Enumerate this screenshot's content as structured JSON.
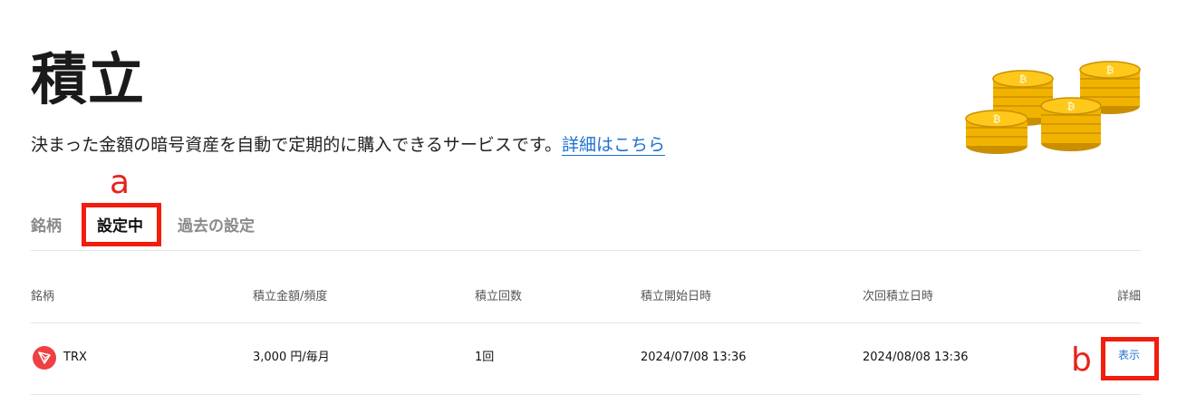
{
  "header": {
    "title": "積立",
    "description": "決まった金額の暗号資産を自動で定期的に購入できるサービスです。",
    "details_link": "詳細はこちら"
  },
  "annotations": {
    "a": "a",
    "b": "b"
  },
  "tabs": [
    {
      "label": "銘柄"
    },
    {
      "label": "設定中",
      "active": true
    },
    {
      "label": "過去の設定"
    }
  ],
  "table": {
    "headers": [
      "銘柄",
      "積立金額/頻度",
      "積立回数",
      "積立開始日時",
      "次回積立日時",
      "詳細"
    ],
    "rows": [
      {
        "coin": "TRX",
        "amount": "3,000 円/毎月",
        "count": "1回",
        "start": "2024/07/08 13:36",
        "next": "2024/08/08 13:36",
        "action": "表示"
      }
    ]
  },
  "colors": {
    "accent": "#1f6fd1",
    "highlight": "#f21d0d",
    "trx": "#ef4042",
    "coin": "#f5b400"
  },
  "icons": {
    "coins": "coin-stack-illustration",
    "trx": "trx-logo-icon"
  }
}
